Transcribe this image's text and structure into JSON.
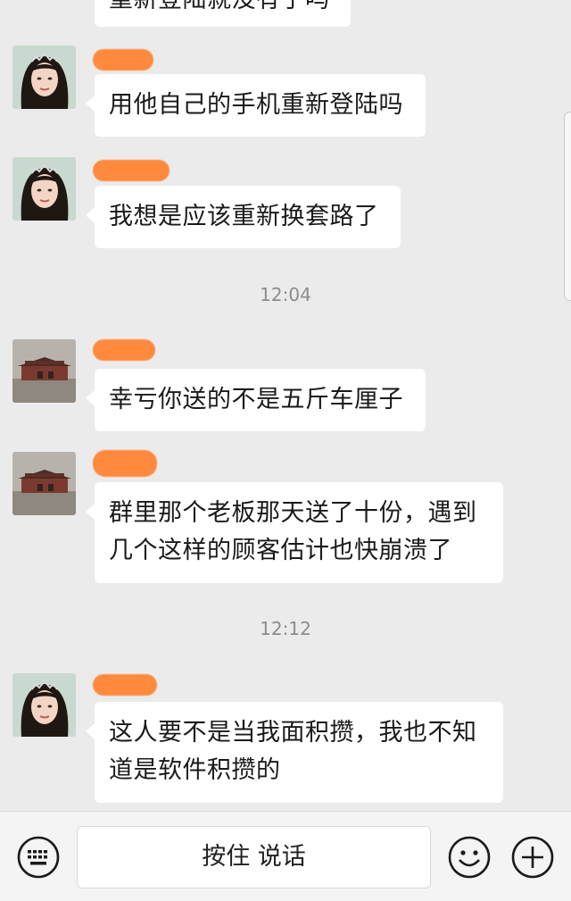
{
  "messages": [
    {
      "text": "重新登陆就没有了吗"
    },
    {
      "text": "用他自己的手机重新登陆吗"
    },
    {
      "text": "我想是应该重新换套路了"
    },
    {
      "text": "幸亏你送的不是五斤车厘子"
    },
    {
      "line1": "群里那个老板那天送了十份，遇到",
      "line2": "几个这样的顾客估计也快崩溃了"
    },
    {
      "line1": "这人要不是当我面积攒，我也不知",
      "line2": "道是软件积攒的"
    }
  ],
  "timestamps": [
    "12:04",
    "12:12"
  ],
  "input_bar": {
    "hold_to_talk": "按住 说话",
    "keyboard_icon": "keyboard-icon",
    "emoji_icon": "emoji-icon",
    "plus_icon": "plus-icon"
  },
  "colors": {
    "background": "#ebebeb",
    "bubble": "#ffffff",
    "redaction": "#ff8a3d"
  }
}
